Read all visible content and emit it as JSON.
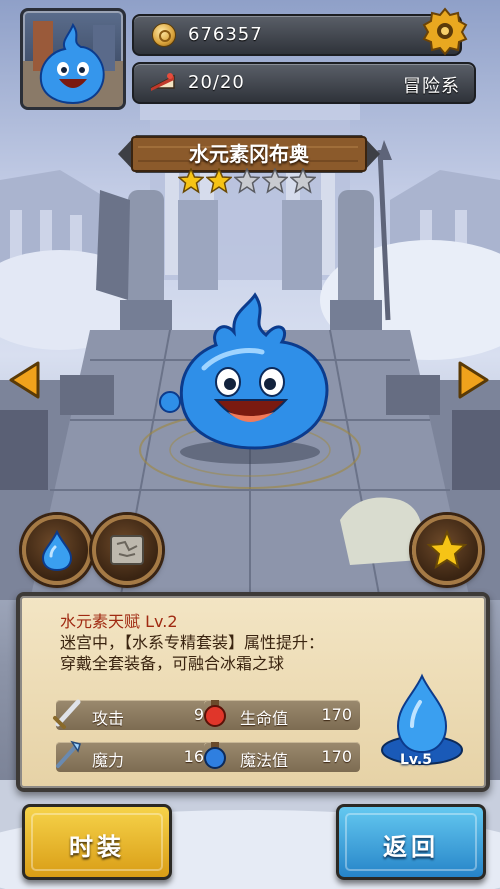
{
  "header": {
    "coins": "676357",
    "stamina": "20/20",
    "element_type": "冒险系"
  },
  "monster": {
    "name": "水元素冈布奥",
    "stars_filled": 2,
    "stars_total": 5
  },
  "talent": {
    "title": "水元素天赋 Lv.2",
    "line1": "迷宫中，【水系专精套装】属性提升：",
    "line2": "穿戴全套装备，可融合冰霜之球"
  },
  "stats": {
    "attack_label": "攻击",
    "attack_value": "9",
    "hp_label": "生命值",
    "hp_value": "170",
    "magic_label": "魔力",
    "magic_value": "16",
    "mp_label": "魔法值",
    "mp_value": "170"
  },
  "level_badge": "Lv.5",
  "buttons": {
    "fashion": "时装",
    "back": "返回"
  },
  "icons": {
    "coin": "coin-icon",
    "settings": "gear-icon",
    "stamina": "cake-slice-icon",
    "prev": "arrow-left-icon",
    "next": "arrow-right-icon",
    "water": "water-drop-icon",
    "map": "map-scroll-icon",
    "favorite": "star-icon",
    "attack": "sword-icon",
    "magic": "staff-icon",
    "hp": "red-potion-icon",
    "mp": "blue-potion-icon"
  },
  "colors": {
    "talent_title": "#a02a12",
    "fashion_button": "#f0c030",
    "back_button": "#3aa0e0",
    "slime": "#2f8fe8"
  }
}
